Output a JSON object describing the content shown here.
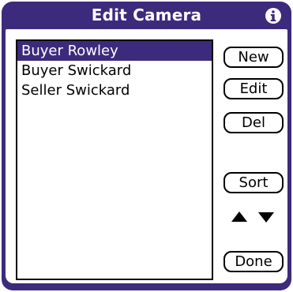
{
  "title": "Edit Camera",
  "icons": {
    "info": "info-icon",
    "scroll_up": "triangle-up-icon",
    "scroll_down": "triangle-down-icon"
  },
  "list": {
    "items": [
      {
        "label": "Buyer Rowley",
        "selected": true
      },
      {
        "label": "Buyer Swickard",
        "selected": false
      },
      {
        "label": "Seller Swickard",
        "selected": false
      }
    ]
  },
  "buttons": {
    "new": "New",
    "edit": "Edit",
    "del": "Del",
    "sort": "Sort",
    "done": "Done"
  },
  "colors": {
    "accent": "#3c2a7c"
  }
}
